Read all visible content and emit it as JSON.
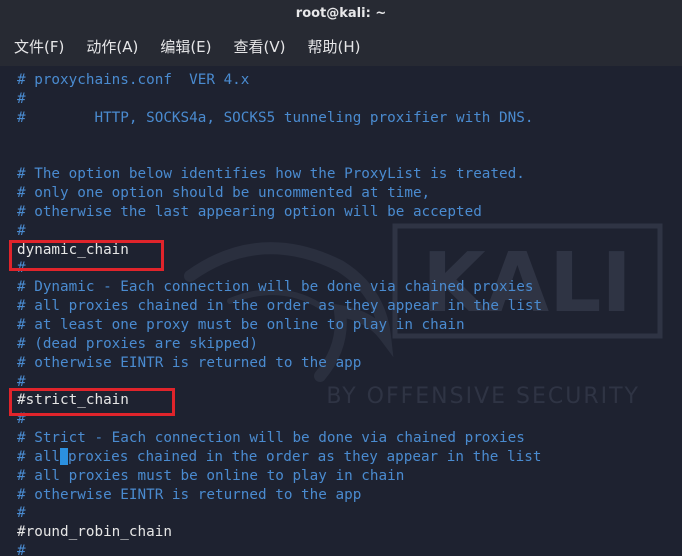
{
  "window": {
    "title": "root@kali: ~"
  },
  "menu": [
    {
      "label": "文件(F)"
    },
    {
      "label": "动作(A)"
    },
    {
      "label": "编辑(E)"
    },
    {
      "label": "查看(V)"
    },
    {
      "label": "帮助(H)"
    }
  ],
  "watermark": {
    "text": "KALI",
    "subtitle": "BY OFFENSIVE SECURITY"
  },
  "terminal": {
    "lines": [
      {
        "text": "# proxychains.conf  VER 4.x",
        "type": "comment"
      },
      {
        "text": "#",
        "type": "comment"
      },
      {
        "text": "#        HTTP, SOCKS4a, SOCKS5 tunneling proxifier with DNS.",
        "type": "comment"
      },
      {
        "text": "",
        "type": "comment"
      },
      {
        "text": "",
        "type": "comment"
      },
      {
        "text": "# The option below identifies how the ProxyList is treated.",
        "type": "comment"
      },
      {
        "text": "# only one option should be uncommented at time,",
        "type": "comment"
      },
      {
        "text": "# otherwise the last appearing option will be accepted",
        "type": "comment"
      },
      {
        "text": "#",
        "type": "comment"
      },
      {
        "text": "dynamic_chain",
        "type": "setting"
      },
      {
        "text": "#",
        "type": "comment"
      },
      {
        "text": "# Dynamic - Each connection will be done via chained proxies",
        "type": "comment"
      },
      {
        "text": "# all proxies chained in the order as they appear in the list",
        "type": "comment"
      },
      {
        "text": "# at least one proxy must be online to play in chain",
        "type": "comment"
      },
      {
        "text": "# (dead proxies are skipped)",
        "type": "comment"
      },
      {
        "text": "# otherwise EINTR is returned to the app",
        "type": "comment"
      },
      {
        "text": "#",
        "type": "comment"
      },
      {
        "text": "#strict_chain",
        "type": "setting"
      },
      {
        "text": "#",
        "type": "comment"
      },
      {
        "text": "# Strict - Each connection will be done via chained proxies",
        "type": "comment"
      },
      {
        "text": "# all proxies chained in the order as they appear in the list",
        "type": "comment",
        "cursor_after": "# all"
      },
      {
        "text": "# all proxies must be online to play in chain",
        "type": "comment"
      },
      {
        "text": "# otherwise EINTR is returned to the app",
        "type": "comment"
      },
      {
        "text": "#",
        "type": "comment"
      },
      {
        "text": "#round_robin_chain",
        "type": "setting"
      },
      {
        "text": "#",
        "type": "comment"
      }
    ]
  },
  "colors": {
    "comment": "#4a8bd0",
    "setting": "#e6e6e6",
    "highlight_box": "#e0242b",
    "background": "#1e2230",
    "cursor": "#2b90e0"
  }
}
